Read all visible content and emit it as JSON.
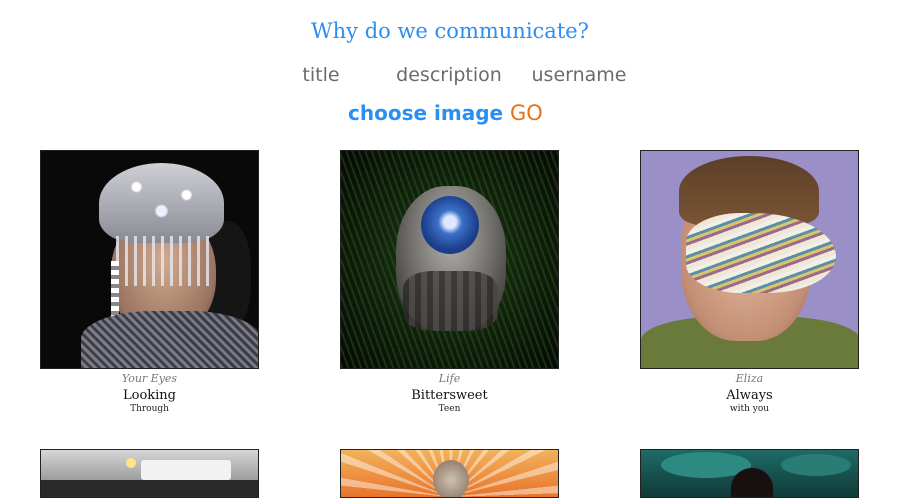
{
  "page": {
    "heading": "Why do we communicate?"
  },
  "form": {
    "title_placeholder": "title",
    "description_placeholder": "description",
    "username_placeholder": "username",
    "choose_image_label": "choose image",
    "go_label": "GO"
  },
  "colors": {
    "accent_blue": "#2b8ef2",
    "go_orange": "#e07416"
  },
  "gallery": [
    {
      "title": "Your Eyes",
      "description": "Looking",
      "username": "Through",
      "image_icon": "crystal-headpiece-portrait-image"
    },
    {
      "title": "Life",
      "description": "Bittersweet",
      "username": "Teen",
      "image_icon": "figure-on-grass-image"
    },
    {
      "title": "Eliza",
      "description": "Always",
      "username": "with you",
      "image_icon": "paint-stroke-portrait-image"
    },
    {
      "image_icon": "storefront-image"
    },
    {
      "image_icon": "orange-rays-figure-image"
    },
    {
      "image_icon": "teal-leaves-portrait-image"
    }
  ]
}
